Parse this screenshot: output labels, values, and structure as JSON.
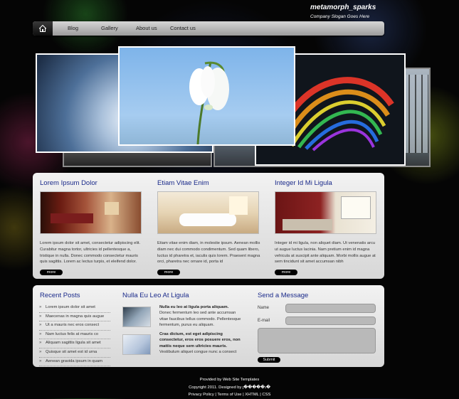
{
  "brand": {
    "name": "metamorph_sparks",
    "slogan": "Company Slogan Goes Here"
  },
  "nav": {
    "items": [
      "Blog",
      "Gallery",
      "About us",
      "Contact us"
    ]
  },
  "colors": {
    "accent": "#1a2a8a",
    "panel": "#e6e6e6",
    "nav": "#b8b8b8",
    "background": "#050505"
  },
  "icons": {
    "home": "home-icon",
    "bullet": "arrow-bullet-icon"
  },
  "slider": {
    "images": [
      "flower-closeup",
      "snowdrop-flower",
      "colorful-swirl",
      "winter-forest",
      "city-reflection"
    ]
  },
  "features": [
    {
      "title": "Lorem Ipsum Dolor",
      "image": "living-room",
      "text": "Lorem ipsum dolor sit amet, consectetur adipiscing elit. Curabitur magna tortor, ultricies id pellentesque a, tristique in nulla. Donec commodo consectetur mauris quis sagittis. Lorem ac lectus turpis, et eleifend dolor.",
      "more": "more"
    },
    {
      "title": "Etiam Vitae Enim",
      "image": "white-dining-room",
      "text": "Etiam vitae enim diam, in molestie ipsum. Aenean mollis diam nec dui commodo condimentum. Sed quam libero, luctus id pharetra et, iaculis quis lorem. Praesent magna orci, pharetra nec ornare id, porta id",
      "more": "more"
    },
    {
      "title": "Integer Id Mi Ligula",
      "image": "red-living-room",
      "text": "Integer id mi ligula, non aliquet diam. Ut venenatis arcu ut augue luctus lacinia. Nam pretium enim id magna vehicula at suscipit ante aliquam. Morbi mollis augue at sem tincidunt sit amet accumsan nibh",
      "more": "more"
    }
  ],
  "recent_posts": {
    "title": "Recent Posts",
    "items": [
      "Lorem ipsum dolor sit amet",
      "Maecenas in magna quis augue",
      "Ut a mauris nec eros consect",
      "Nam luctus felis at mauris co",
      "Aliquam sagittis ligula sit amet",
      "Quisque sit amet est id urna",
      "Aenean gravida ipsum in quam"
    ]
  },
  "news": {
    "title": "Nulla Eu Leo At Ligula",
    "items": [
      {
        "bold": "Nulla eu leo at ligula porta aliquam.",
        "text": "Donec fermentum leo sed ante accumsan vitae faucibus tellus commodo. Pellentesque fermentum, purus eu aliquam."
      },
      {
        "bold": "Cras dictum, est eget adipiscing consectetur, eros eros posuere eros, non mattis neque sem ultricies mauris.",
        "text": "Vestibulum aliquet congue nunc a consect"
      }
    ]
  },
  "contact": {
    "title": "Send a Message",
    "name_label": "Name",
    "email_label": "E-mail",
    "name_value": "",
    "email_value": "",
    "message_value": "",
    "submit": "Submit"
  },
  "footer": {
    "line1": "Provided by Web Site Templates",
    "line2": "Copyright 2011. Designed by ȷ�����ɹ�",
    "privacy": "Privacy Policy",
    "terms": "Terms of Use",
    "xhtml": "XHTML",
    "css": "CSS"
  }
}
